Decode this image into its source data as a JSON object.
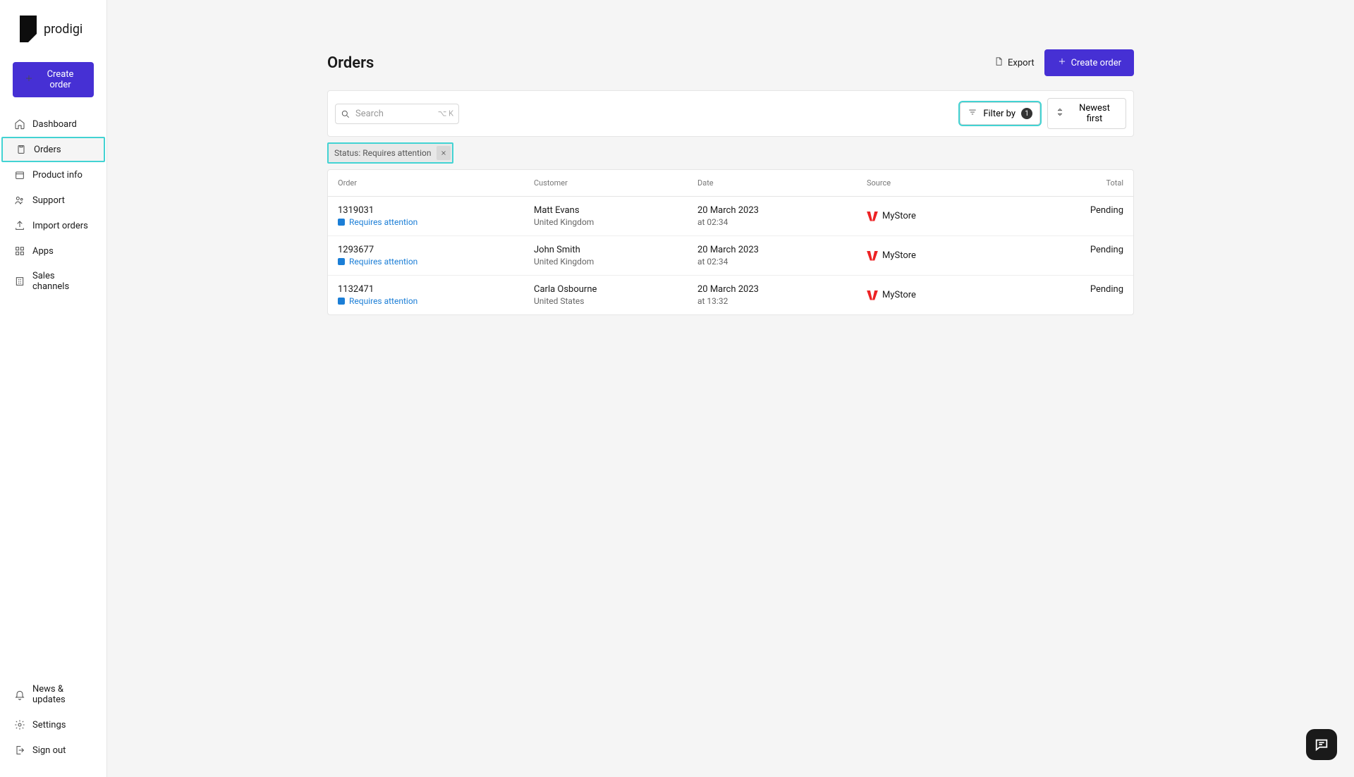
{
  "brand": {
    "name": "prodigi"
  },
  "sidebar": {
    "create_label": "Create order",
    "items": [
      {
        "label": "Dashboard"
      },
      {
        "label": "Orders"
      },
      {
        "label": "Product info"
      },
      {
        "label": "Support"
      },
      {
        "label": "Import orders"
      },
      {
        "label": "Apps"
      },
      {
        "label": "Sales channels"
      }
    ],
    "bottom": [
      {
        "label": "News & updates"
      },
      {
        "label": "Settings"
      },
      {
        "label": "Sign out"
      }
    ]
  },
  "page": {
    "title": "Orders"
  },
  "header": {
    "export_label": "Export",
    "create_label": "Create order"
  },
  "search": {
    "placeholder": "Search",
    "shortcut": "⌥ K"
  },
  "filter": {
    "label": "Filter by",
    "count": "1"
  },
  "sort": {
    "label": "Newest first"
  },
  "chip": {
    "label": "Status: Requires attention"
  },
  "columns": {
    "order": "Order",
    "customer": "Customer",
    "date": "Date",
    "source": "Source",
    "total": "Total"
  },
  "rows": [
    {
      "order_id": "1319031",
      "status": "Requires attention",
      "customer": "Matt Evans",
      "country": "United Kingdom",
      "date": "20 March 2023",
      "time": "at 02:34",
      "source": "MyStore",
      "total": "Pending"
    },
    {
      "order_id": "1293677",
      "status": "Requires attention",
      "customer": "John Smith",
      "country": "United Kingdom",
      "date": "20 March 2023",
      "time": "at 02:34",
      "source": "MyStore",
      "total": "Pending"
    },
    {
      "order_id": "1132471",
      "status": "Requires attention",
      "customer": "Carla Osbourne",
      "country": "United States",
      "date": "20 March 2023",
      "time": "at 13:32",
      "source": "MyStore",
      "total": "Pending"
    }
  ]
}
